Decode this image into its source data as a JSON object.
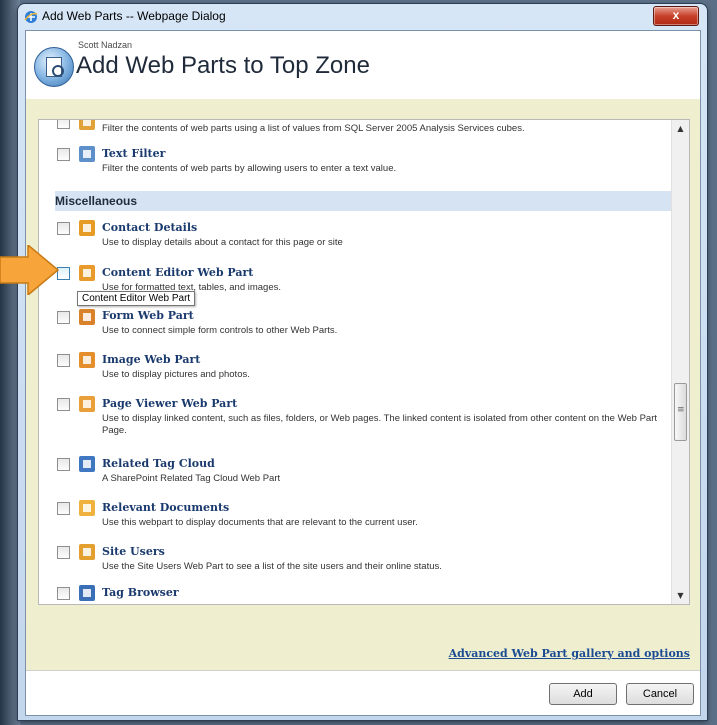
{
  "window": {
    "title": "Add Web Parts -- Webpage Dialog",
    "close_label": "x"
  },
  "header": {
    "subtitle": "Scott Nadzan",
    "title": "Add Web Parts to Top Zone"
  },
  "list": {
    "partial_item": {
      "name": "",
      "description": "Filter the contents of web parts using a list of values from SQL Server 2005 Analysis Services cubes."
    },
    "items": [
      {
        "name": "Text Filter",
        "description": "Filter the contents of web parts by allowing users to enter a text value.",
        "icon": "text-filter-icon",
        "color": "#5d8fc9"
      },
      {
        "name": "Contact Details",
        "description": "Use to display details about a contact for this page or site",
        "icon": "contact-details-icon",
        "color": "#e59b24"
      },
      {
        "name": "Content Editor Web Part",
        "description": "Use for formatted text, tables, and images.",
        "icon": "content-editor-icon",
        "color": "#e89a2b"
      },
      {
        "name": "Form Web Part",
        "description": "Use to connect simple form controls to other Web Parts.",
        "icon": "form-web-part-icon",
        "color": "#d9822b"
      },
      {
        "name": "Image Web Part",
        "description": "Use to display pictures and photos.",
        "icon": "image-web-part-icon",
        "color": "#e58f2c"
      },
      {
        "name": "Page Viewer Web Part",
        "description": "Use to display linked content, such as files, folders, or Web pages. The linked content is isolated from other content on the Web Part Page.",
        "icon": "page-viewer-icon",
        "color": "#e9a03a"
      },
      {
        "name": "Related Tag Cloud",
        "description": "A SharePoint Related Tag Cloud Web Part",
        "icon": "related-tag-cloud-icon",
        "color": "#3f78c0"
      },
      {
        "name": "Relevant Documents",
        "description": "Use this webpart to display documents that are relevant to the current user.",
        "icon": "relevant-documents-icon",
        "color": "#efb23f"
      },
      {
        "name": "Site Users",
        "description": "Use the Site Users Web Part to see a list of the site users and their online status.",
        "icon": "site-users-icon",
        "color": "#e3a02f"
      },
      {
        "name": "Tag Browser",
        "description": "",
        "icon": "tag-browser-icon",
        "color": "#3a6fb5"
      }
    ],
    "category_label": "Miscellaneous",
    "tooltip": "Content Editor Web Part"
  },
  "links": {
    "advanced": "Advanced Web Part gallery and options"
  },
  "footer": {
    "add_label": "Add",
    "cancel_label": "Cancel"
  },
  "colors": {
    "category_bg": "#d5e3f3",
    "body_bg": "#efefd0",
    "arrow": "#f7a43a",
    "link": "#1b4b93"
  }
}
